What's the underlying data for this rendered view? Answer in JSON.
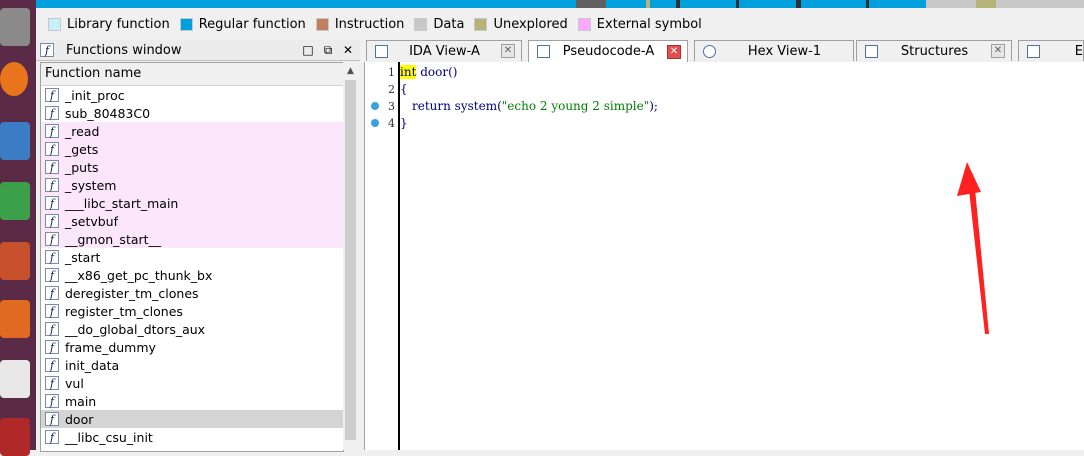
{
  "legend": [
    {
      "label": "Library function",
      "color": "#c8f0f8"
    },
    {
      "label": "Regular function",
      "color": "#00a0dc"
    },
    {
      "label": "Instruction",
      "color": "#c08060"
    },
    {
      "label": "Data",
      "color": "#c8c8c8"
    },
    {
      "label": "Unexplored",
      "color": "#b4b478"
    },
    {
      "label": "External symbol",
      "color": "#ffa8ff"
    }
  ],
  "functions_window": {
    "title": "Functions window",
    "column_header": "Function name",
    "items": [
      {
        "name": "_init_proc",
        "kind": "regular"
      },
      {
        "name": "sub_80483C0",
        "kind": "regular"
      },
      {
        "name": "_read",
        "kind": "external"
      },
      {
        "name": "_gets",
        "kind": "external"
      },
      {
        "name": "_puts",
        "kind": "external"
      },
      {
        "name": "_system",
        "kind": "external"
      },
      {
        "name": "___libc_start_main",
        "kind": "external"
      },
      {
        "name": "_setvbuf",
        "kind": "external"
      },
      {
        "name": "__gmon_start__",
        "kind": "external"
      },
      {
        "name": "_start",
        "kind": "regular"
      },
      {
        "name": "__x86_get_pc_thunk_bx",
        "kind": "regular"
      },
      {
        "name": "deregister_tm_clones",
        "kind": "regular"
      },
      {
        "name": "register_tm_clones",
        "kind": "regular"
      },
      {
        "name": "__do_global_dtors_aux",
        "kind": "regular"
      },
      {
        "name": "frame_dummy",
        "kind": "regular"
      },
      {
        "name": "init_data",
        "kind": "regular"
      },
      {
        "name": "vul",
        "kind": "regular"
      },
      {
        "name": "main",
        "kind": "regular"
      },
      {
        "name": "door",
        "kind": "selected"
      },
      {
        "name": "__libc_csu_init",
        "kind": "regular"
      }
    ]
  },
  "tabs": [
    {
      "label": "IDA View-A",
      "active": false
    },
    {
      "label": "Pseudocode-A",
      "active": true
    },
    {
      "label": "Hex View-1",
      "active": false
    },
    {
      "label": "Structures",
      "active": false
    },
    {
      "label": "E",
      "active": false
    }
  ],
  "code": {
    "line_numbers": [
      "1",
      "2",
      "3",
      "4"
    ],
    "l1_kw": "int",
    "l1_rest": " door()",
    "l2": "{",
    "l3_kw": "return",
    "l3_fn": " system(",
    "l3_str": "\"echo 2 young 2 simple\"",
    "l3_end": ");",
    "l4": "}"
  },
  "colors": {
    "accent_arrow": "#ff2020",
    "external_row": "#fce6fc",
    "selected_row": "#d4d4d4"
  }
}
